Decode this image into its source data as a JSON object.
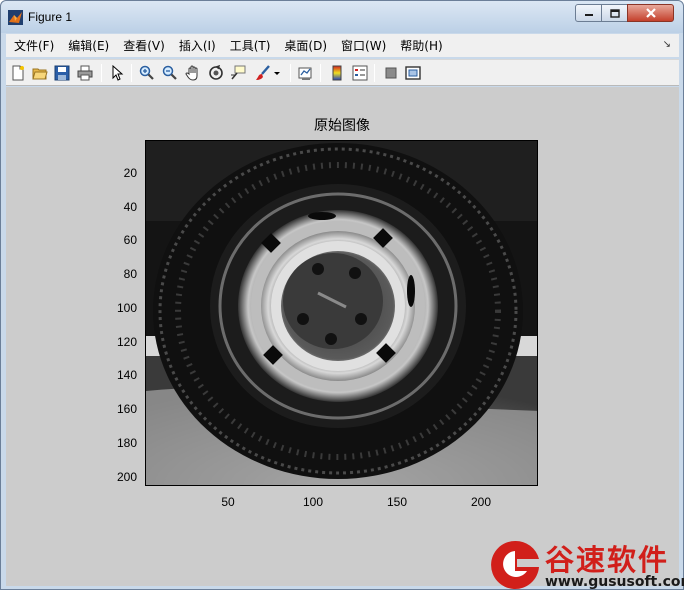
{
  "window": {
    "title": "Figure 1",
    "controls": {
      "minimize_icon": "minimize-icon",
      "maximize_icon": "maximize-icon",
      "close_icon": "close-icon"
    }
  },
  "menubar": {
    "items": [
      "文件(F)",
      "编辑(E)",
      "查看(V)",
      "插入(I)",
      "工具(T)",
      "桌面(D)",
      "窗口(W)",
      "帮助(H)"
    ],
    "overflow_icon": "dock-arrow-icon"
  },
  "toolbar": {
    "buttons": [
      "new-figure-icon",
      "open-file-icon",
      "save-icon",
      "print-icon",
      "pointer-icon",
      "zoom-in-icon",
      "zoom-out-icon",
      "pan-hand-icon",
      "rotate-3d-icon",
      "data-cursor-icon",
      "brush-icon",
      "brush-dropdown-icon",
      "link-plot-icon",
      "colorbar-icon",
      "legend-icon",
      "hide-plot-tools-icon",
      "show-plot-tools-icon"
    ]
  },
  "plot": {
    "title": "原始图像",
    "y_ticks": [
      "20",
      "40",
      "60",
      "80",
      "100",
      "120",
      "140",
      "160",
      "180",
      "200"
    ],
    "x_ticks": [
      "50",
      "100",
      "150",
      "200"
    ],
    "image_description_icon": "tire-image"
  },
  "watermark": {
    "name": "谷速软件",
    "url": "www.gususoft.com",
    "logo_icon": "gusu-logo-icon",
    "brand_color": "#d11f1a"
  },
  "colors": {
    "figure_background": "#cccccc",
    "menubar_background": "#f0f0f0",
    "titlebar": "#c9d9ea"
  }
}
